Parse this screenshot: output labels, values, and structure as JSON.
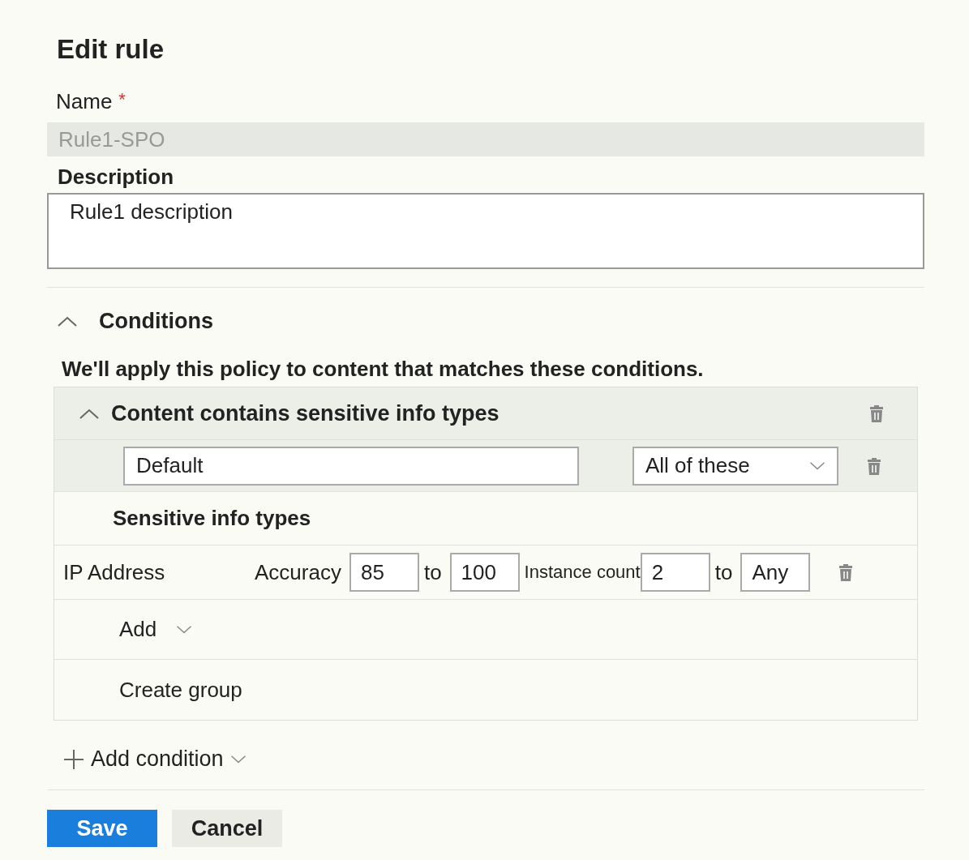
{
  "title": "Edit rule",
  "name_field": {
    "label": "Name",
    "required_mark": "*",
    "value": "Rule1-SPO",
    "disabled": true
  },
  "description": {
    "label": "Description",
    "value": "Rule1 description"
  },
  "conditions": {
    "title": "Conditions",
    "expanded": true,
    "intro": "We'll apply this policy to content that matches these conditions.",
    "group": {
      "title": "Content contains sensitive info types",
      "expanded": true,
      "group_name": "Default",
      "operator": "All of these",
      "section_title": "Sensitive info types",
      "items": [
        {
          "name": "IP Address",
          "accuracy_label": "Accuracy",
          "accuracy_min": "85",
          "to_1": "to",
          "accuracy_max": "100",
          "count_label": "Instance count",
          "count_min": "2",
          "to_2": "to",
          "count_max": "Any"
        }
      ],
      "add": "Add",
      "create_group": "Create group"
    },
    "add_condition": "Add condition"
  },
  "buttons": [
    {
      "label": "Save",
      "kind": "primary"
    },
    {
      "label": "Cancel",
      "kind": "secondary"
    }
  ]
}
